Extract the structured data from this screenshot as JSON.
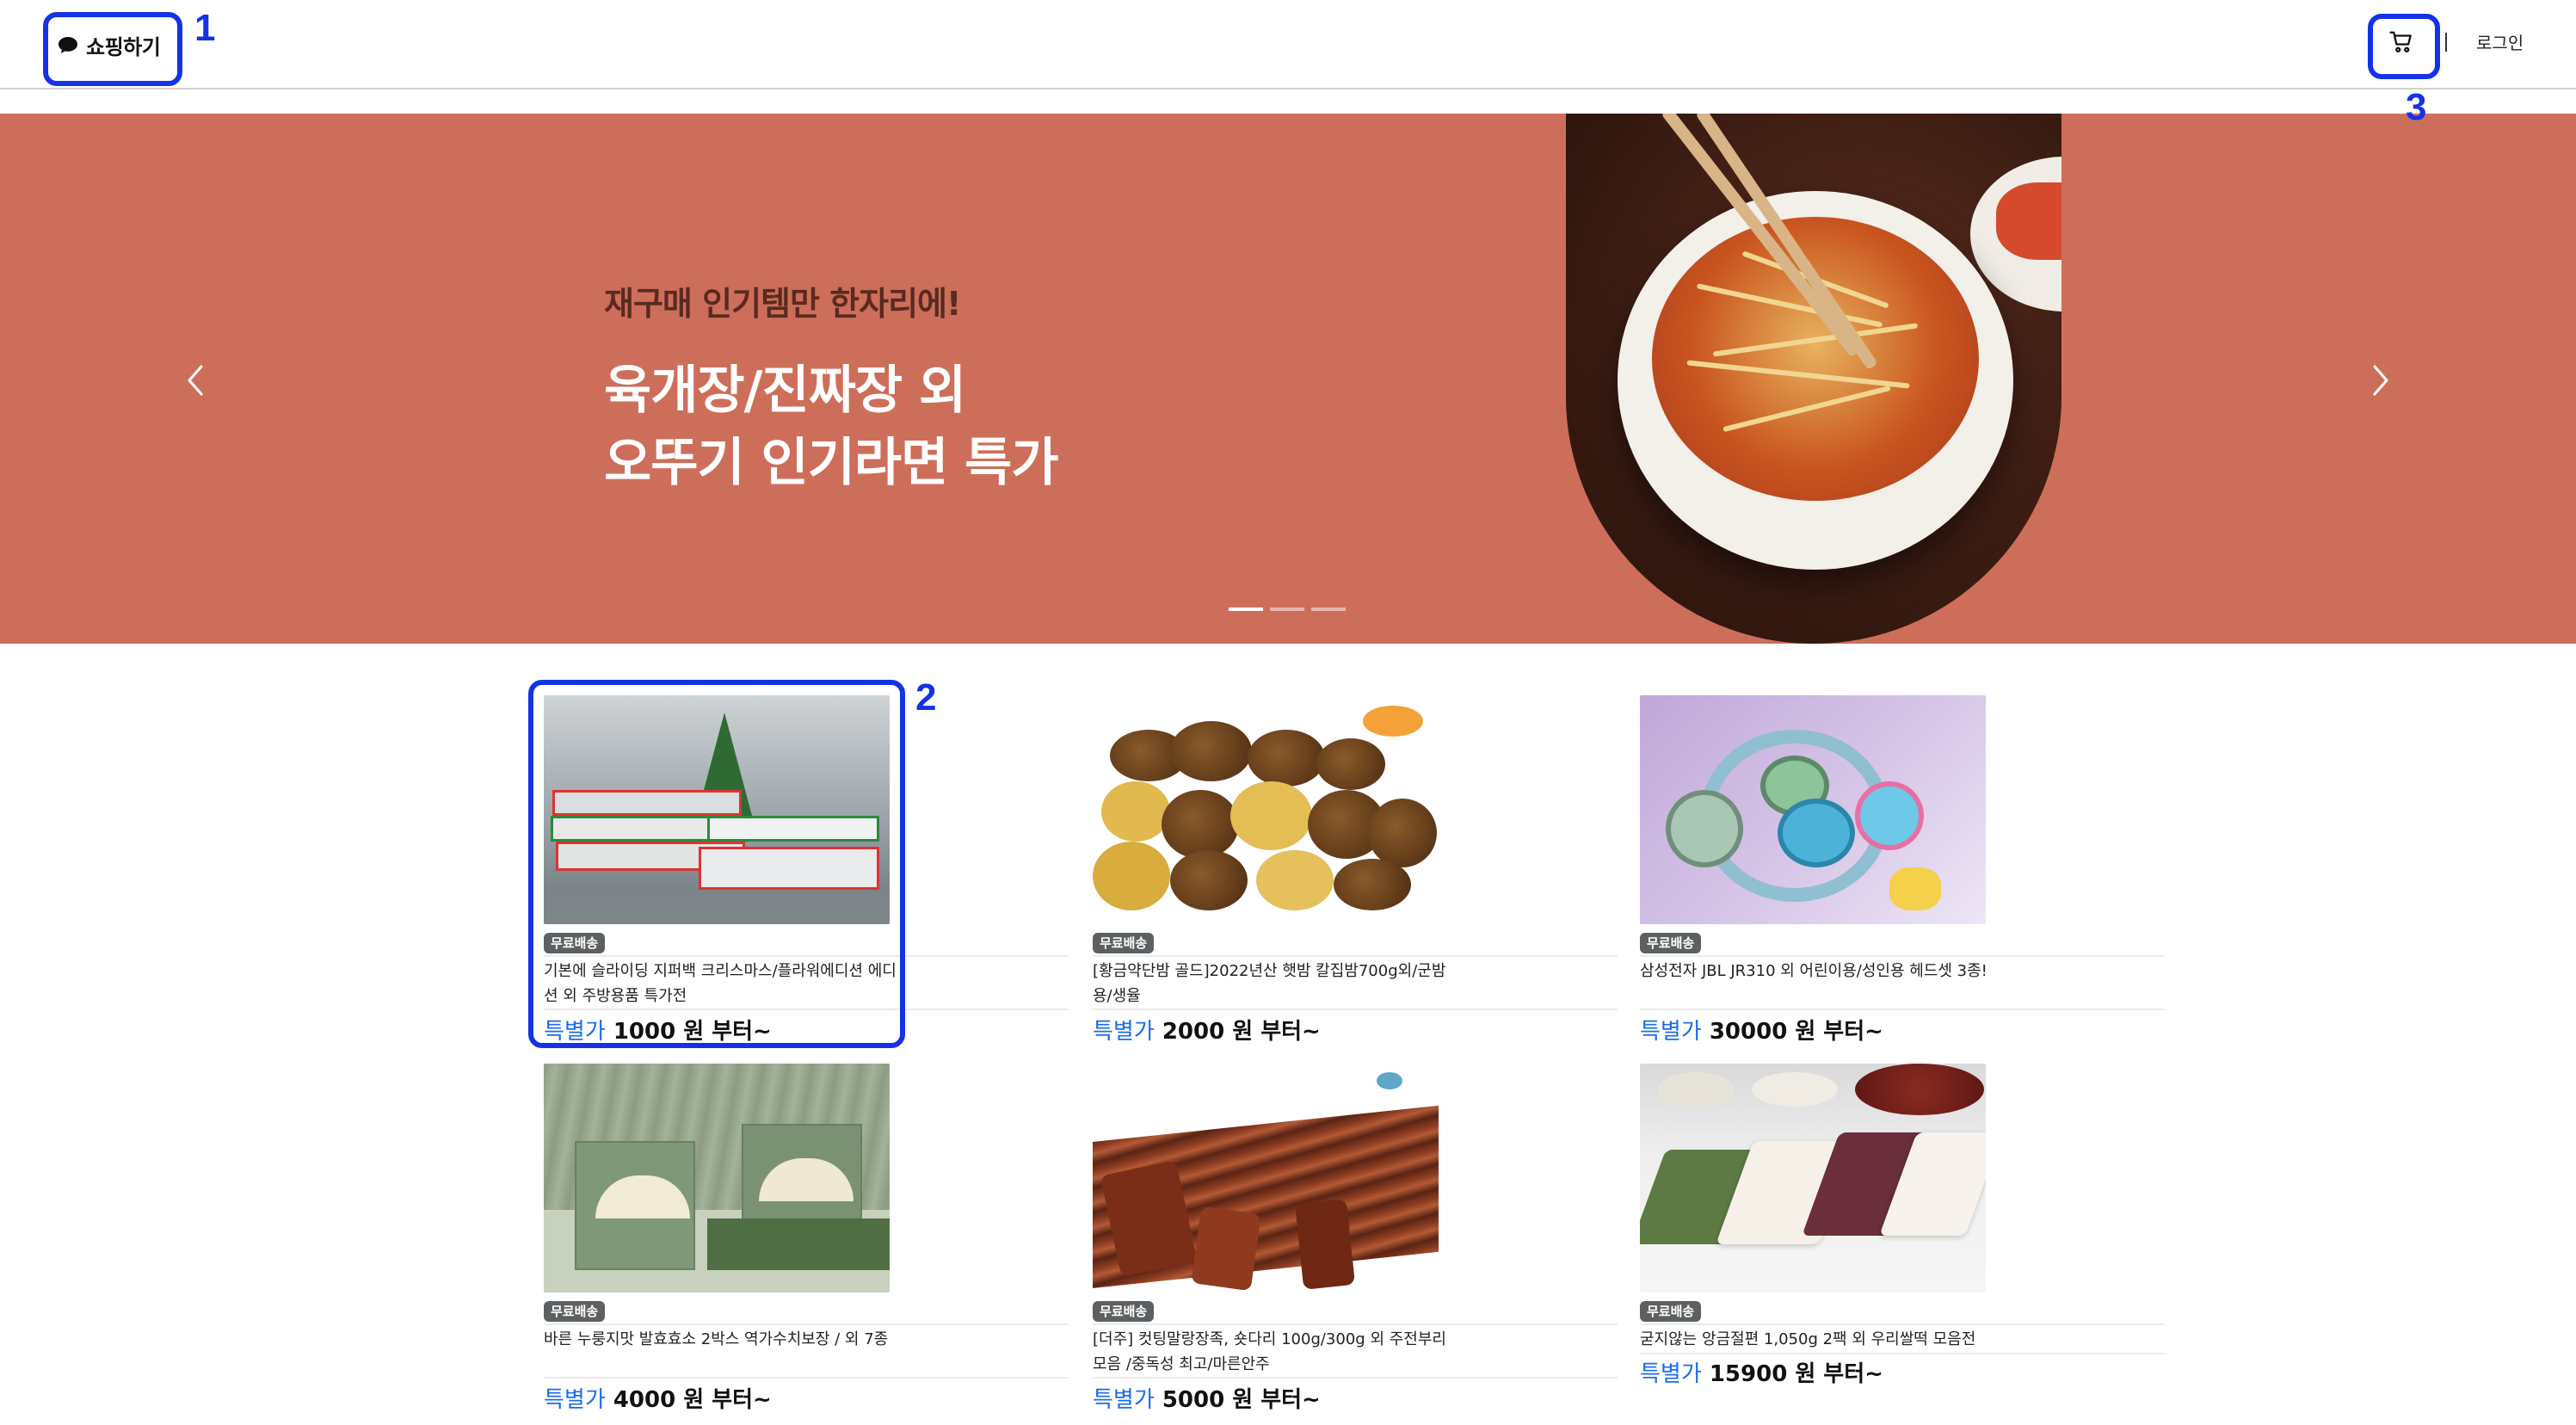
{
  "header": {
    "logo_label": "쇼핑하기",
    "login_label": "로그인",
    "cart_icon": "cart-icon"
  },
  "banner": {
    "subtitle": "재구매 인기템만 한자리에!",
    "title_line1": "육개장/진짜장 외",
    "title_line2": "오뚜기 인기라면 특가",
    "background": "#cd6e5b",
    "slide_count": 3,
    "active_slide": 1
  },
  "annotations": [
    {
      "label": "1"
    },
    {
      "label": "2"
    },
    {
      "label": "3"
    }
  ],
  "products": [
    {
      "badge": "무료배송",
      "name": "기본에 슬라이딩 지퍼백 크리스마스/플라워에디션 에디션 외 주방용품 특가전",
      "special_label": "특별가",
      "price_text": "1000 원 부터~"
    },
    {
      "badge": "무료배송",
      "name": "[황금약단밤 골드]2022년산 햇밤 칼집밤700g외/군밤용/생율",
      "special_label": "특별가",
      "price_text": "2000 원 부터~"
    },
    {
      "badge": "무료배송",
      "name": "삼성전자 JBL JR310 외 어린이용/성인용 헤드셋 3종!",
      "special_label": "특별가",
      "price_text": "30000 원 부터~"
    },
    {
      "badge": "무료배송",
      "name": "바른 누룽지맛 발효효소 2박스 역가수치보장 / 외 7종",
      "special_label": "특별가",
      "price_text": "4000 원 부터~"
    },
    {
      "badge": "무료배송",
      "name": "[더주] 컷팅말랑장족, 숏다리 100g/300g 외 주전부리 모음 /중독성 최고/마른안주",
      "special_label": "특별가",
      "price_text": "5000 원 부터~"
    },
    {
      "badge": "무료배송",
      "name": "굳지않는 앙금절편 1,050g 2팩 외 우리쌀떡 모음전",
      "special_label": "특별가",
      "price_text": "15900 원 부터~"
    }
  ],
  "colors": {
    "accent_blue": "#1a6cf0",
    "badge_gray": "#5c6062",
    "annotation_blue": "#1432e6"
  }
}
